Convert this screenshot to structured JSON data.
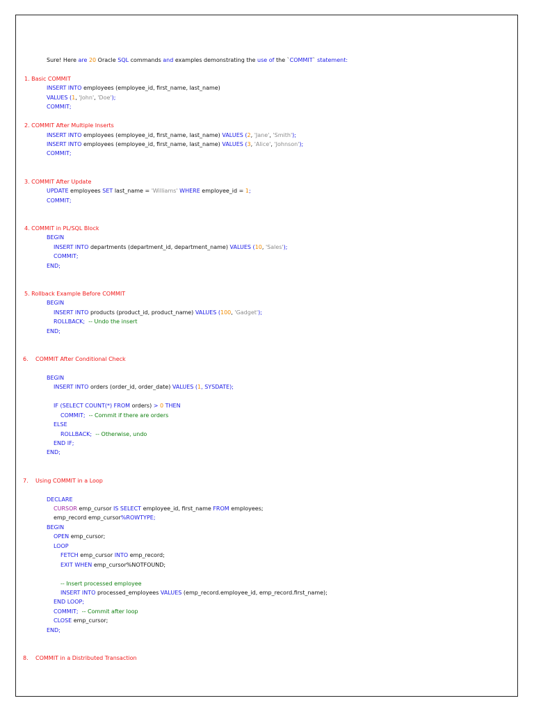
{
  "lines": [
    {
      "kind": "code",
      "indent": 0,
      "tokens": [
        [
          "Sure! Here ",
          "pl"
        ],
        [
          "are",
          "kw"
        ],
        [
          " ",
          "pl"
        ],
        [
          "20",
          "num"
        ],
        [
          " Oracle ",
          "pl"
        ],
        [
          "SQL",
          "kw"
        ],
        [
          " commands ",
          "pl"
        ],
        [
          "and",
          "kw"
        ],
        [
          " examples demonstrating the ",
          "pl"
        ],
        [
          "use of",
          "kw"
        ],
        [
          " the `",
          "pl"
        ],
        [
          "COMMIT",
          "kw"
        ],
        [
          "` ",
          "pl"
        ],
        [
          "statement:",
          "kw"
        ]
      ]
    },
    {
      "kind": "blank"
    },
    {
      "kind": "heading",
      "text": "1. Basic COMMIT"
    },
    {
      "kind": "code",
      "indent": 0,
      "tokens": [
        [
          "INSERT INTO",
          "kw"
        ],
        [
          " employees (employee_id, first_name, last_name)",
          "pl"
        ]
      ]
    },
    {
      "kind": "code",
      "indent": 0,
      "tokens": [
        [
          "VALUES",
          "kw"
        ],
        [
          " (",
          "kw"
        ],
        [
          "1",
          "num"
        ],
        [
          ", ",
          "pl"
        ],
        [
          "'John'",
          "str"
        ],
        [
          ", ",
          "pl"
        ],
        [
          "'Doe'",
          "str"
        ],
        [
          ");",
          "kw"
        ]
      ]
    },
    {
      "kind": "code",
      "indent": 0,
      "tokens": [
        [
          "COMMIT;",
          "kw"
        ]
      ]
    },
    {
      "kind": "blank"
    },
    {
      "kind": "heading",
      "text": "2. COMMIT After Multiple Inserts"
    },
    {
      "kind": "code",
      "indent": 0,
      "tokens": [
        [
          "INSERT INTO",
          "kw"
        ],
        [
          " employees (employee_id, first_name, last_name) ",
          "pl"
        ],
        [
          "VALUES",
          "kw"
        ],
        [
          " (",
          "kw"
        ],
        [
          "2",
          "num"
        ],
        [
          ", ",
          "pl"
        ],
        [
          "'Jane'",
          "str"
        ],
        [
          ", ",
          "pl"
        ],
        [
          "'Smith'",
          "str"
        ],
        [
          ");",
          "kw"
        ]
      ]
    },
    {
      "kind": "code",
      "indent": 0,
      "tokens": [
        [
          "INSERT INTO",
          "kw"
        ],
        [
          " employees (employee_id, first_name, last_name) ",
          "pl"
        ],
        [
          "VALUES",
          "kw"
        ],
        [
          " (",
          "kw"
        ],
        [
          "3",
          "num"
        ],
        [
          ", ",
          "pl"
        ],
        [
          "'Alice'",
          "str"
        ],
        [
          ", ",
          "pl"
        ],
        [
          "'Johnson'",
          "str"
        ],
        [
          ");",
          "kw"
        ]
      ]
    },
    {
      "kind": "code",
      "indent": 0,
      "tokens": [
        [
          "COMMIT;",
          "kw"
        ]
      ]
    },
    {
      "kind": "blank"
    },
    {
      "kind": "blank"
    },
    {
      "kind": "heading",
      "text": "3. COMMIT After Update"
    },
    {
      "kind": "code",
      "indent": 0,
      "tokens": [
        [
          "UPDATE",
          "kw"
        ],
        [
          " employees ",
          "pl"
        ],
        [
          "SET",
          "kw"
        ],
        [
          " last_name = ",
          "pl"
        ],
        [
          "'Williams'",
          "str"
        ],
        [
          " ",
          "pl"
        ],
        [
          "WHERE",
          "kw"
        ],
        [
          " employee_id = ",
          "pl"
        ],
        [
          "1",
          "num"
        ],
        [
          ";",
          "kw"
        ]
      ]
    },
    {
      "kind": "code",
      "indent": 0,
      "tokens": [
        [
          "COMMIT;",
          "kw"
        ]
      ]
    },
    {
      "kind": "blank"
    },
    {
      "kind": "blank"
    },
    {
      "kind": "heading",
      "text": "4. COMMIT in PL/SQL Block"
    },
    {
      "kind": "code",
      "indent": 0,
      "tokens": [
        [
          "BEGIN",
          "kw"
        ]
      ]
    },
    {
      "kind": "code",
      "indent": 1,
      "tokens": [
        [
          "INSERT INTO",
          "kw"
        ],
        [
          " departments (department_id, department_name) ",
          "pl"
        ],
        [
          "VALUES",
          "kw"
        ],
        [
          " (",
          "kw"
        ],
        [
          "10",
          "num"
        ],
        [
          ", ",
          "pl"
        ],
        [
          "'Sales'",
          "str"
        ],
        [
          ");",
          "kw"
        ]
      ]
    },
    {
      "kind": "code",
      "indent": 1,
      "tokens": [
        [
          "COMMIT;",
          "kw"
        ]
      ]
    },
    {
      "kind": "code",
      "indent": 0,
      "tokens": [
        [
          "END;",
          "kw"
        ]
      ]
    },
    {
      "kind": "blank"
    },
    {
      "kind": "blank"
    },
    {
      "kind": "heading",
      "text": "5. Rollback Example Before COMMIT"
    },
    {
      "kind": "code",
      "indent": 0,
      "tokens": [
        [
          "BEGIN",
          "kw"
        ]
      ]
    },
    {
      "kind": "code",
      "indent": 1,
      "tokens": [
        [
          "INSERT INTO",
          "kw"
        ],
        [
          " products (product_id, product_name) ",
          "pl"
        ],
        [
          "VALUES",
          "kw"
        ],
        [
          " (",
          "kw"
        ],
        [
          "100",
          "num"
        ],
        [
          ", ",
          "pl"
        ],
        [
          "'Gadget'",
          "str"
        ],
        [
          ");",
          "kw"
        ]
      ]
    },
    {
      "kind": "code",
      "indent": 1,
      "tokens": [
        [
          "ROLLBACK;",
          "kw"
        ],
        [
          "  -- Undo the insert",
          "cm"
        ]
      ]
    },
    {
      "kind": "code",
      "indent": 0,
      "tokens": [
        [
          "END;",
          "kw"
        ]
      ]
    },
    {
      "kind": "blank"
    },
    {
      "kind": "blank"
    },
    {
      "kind": "numbered",
      "num": "6.",
      "text": "COMMIT After Conditional Check"
    },
    {
      "kind": "blank"
    },
    {
      "kind": "code",
      "indent": 0,
      "tokens": [
        [
          "BEGIN",
          "kw"
        ]
      ]
    },
    {
      "kind": "code",
      "indent": 1,
      "tokens": [
        [
          "INSERT INTO",
          "kw"
        ],
        [
          " orders (order_id, order_date) ",
          "pl"
        ],
        [
          "VALUES",
          "kw"
        ],
        [
          " (",
          "kw"
        ],
        [
          "1",
          "num"
        ],
        [
          ", SYSDATE);",
          "kw"
        ]
      ]
    },
    {
      "kind": "blank"
    },
    {
      "kind": "code",
      "indent": 1,
      "tokens": [
        [
          "IF (SELECT COUNT(*) FROM",
          "kw"
        ],
        [
          " orders) ",
          "pl"
        ],
        [
          "> ",
          "kw"
        ],
        [
          "0",
          "num"
        ],
        [
          " THEN",
          "kw"
        ]
      ]
    },
    {
      "kind": "code",
      "indent": 2,
      "tokens": [
        [
          "COMMIT;",
          "kw"
        ],
        [
          "  -- Commit if there are orders",
          "cm"
        ]
      ]
    },
    {
      "kind": "code",
      "indent": 1,
      "tokens": [
        [
          "ELSE",
          "kw"
        ]
      ]
    },
    {
      "kind": "code",
      "indent": 2,
      "tokens": [
        [
          "ROLLBACK;",
          "kw"
        ],
        [
          "  -- Otherwise, undo",
          "cm"
        ]
      ]
    },
    {
      "kind": "code",
      "indent": 1,
      "tokens": [
        [
          "END IF;",
          "kw"
        ]
      ]
    },
    {
      "kind": "code",
      "indent": 0,
      "tokens": [
        [
          "END;",
          "kw"
        ]
      ]
    },
    {
      "kind": "blank"
    },
    {
      "kind": "blank"
    },
    {
      "kind": "numbered",
      "num": "7.",
      "text": "Using COMMIT in a Loop"
    },
    {
      "kind": "blank"
    },
    {
      "kind": "code",
      "indent": 0,
      "tokens": [
        [
          "DECLARE",
          "kw"
        ]
      ]
    },
    {
      "kind": "code",
      "indent": 1,
      "tokens": [
        [
          "CURSOR",
          "pu"
        ],
        [
          " emp_cursor ",
          "pl"
        ],
        [
          "IS SELECT",
          "kw"
        ],
        [
          " employee_id, first_name ",
          "pl"
        ],
        [
          "FROM",
          "kw"
        ],
        [
          " employees;",
          "pl"
        ]
      ]
    },
    {
      "kind": "code",
      "indent": 1,
      "tokens": [
        [
          "emp_record emp_cursor",
          "pl"
        ],
        [
          "%ROWTYPE;",
          "kw"
        ]
      ]
    },
    {
      "kind": "code",
      "indent": 0,
      "tokens": [
        [
          "BEGIN",
          "kw"
        ]
      ]
    },
    {
      "kind": "code",
      "indent": 1,
      "tokens": [
        [
          "OPEN",
          "kw"
        ],
        [
          " emp_cursor;",
          "pl"
        ]
      ]
    },
    {
      "kind": "code",
      "indent": 1,
      "tokens": [
        [
          "LOOP",
          "kw"
        ]
      ]
    },
    {
      "kind": "code",
      "indent": 2,
      "tokens": [
        [
          "FETCH",
          "kw"
        ],
        [
          " emp_cursor ",
          "pl"
        ],
        [
          "INTO",
          "kw"
        ],
        [
          " emp_record;",
          "pl"
        ]
      ]
    },
    {
      "kind": "code",
      "indent": 2,
      "tokens": [
        [
          "EXIT WHEN",
          "kw"
        ],
        [
          " emp_cursor%NOTFOUND;",
          "pl"
        ]
      ]
    },
    {
      "kind": "blank"
    },
    {
      "kind": "code",
      "indent": 2,
      "tokens": [
        [
          "-- Insert processed employee",
          "cm"
        ]
      ]
    },
    {
      "kind": "code",
      "indent": 2,
      "tokens": [
        [
          "INSERT INTO",
          "kw"
        ],
        [
          " processed_employees ",
          "pl"
        ],
        [
          "VALUES",
          "kw"
        ],
        [
          " (emp_record.employee_id, emp_record.first_name);",
          "pl"
        ]
      ]
    },
    {
      "kind": "code",
      "indent": 1,
      "tokens": [
        [
          "END LOOP;",
          "kw"
        ]
      ]
    },
    {
      "kind": "code",
      "indent": 1,
      "tokens": [
        [
          "COMMIT;",
          "kw"
        ],
        [
          "  -- Commit after loop",
          "cm"
        ]
      ]
    },
    {
      "kind": "code",
      "indent": 1,
      "tokens": [
        [
          "CLOSE",
          "kw"
        ],
        [
          " emp_cursor;",
          "pl"
        ]
      ]
    },
    {
      "kind": "code",
      "indent": 0,
      "tokens": [
        [
          "END;",
          "kw"
        ]
      ]
    },
    {
      "kind": "blank"
    },
    {
      "kind": "blank"
    },
    {
      "kind": "numbered",
      "num": "8.",
      "text": "COMMIT in a Distributed Transaction"
    }
  ]
}
